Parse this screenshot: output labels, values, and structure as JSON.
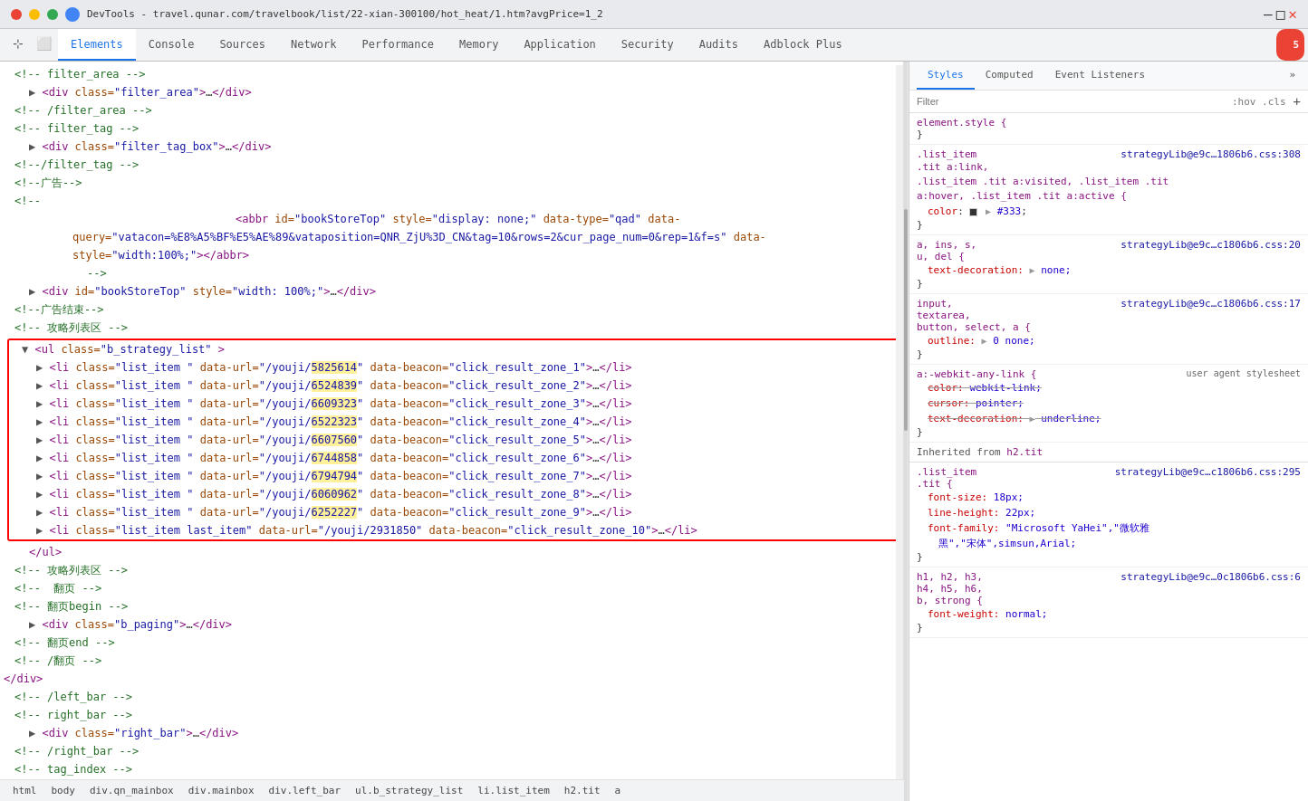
{
  "window": {
    "title": "DevTools - travel.qunar.com/travelbook/list/22-xian-300100/hot_heat/1.htm?avgPrice=1_2",
    "minimize_btn": "—",
    "maximize_btn": "□",
    "close_btn": "✕"
  },
  "tabs": {
    "items": [
      {
        "label": "Elements",
        "active": true
      },
      {
        "label": "Console",
        "active": false
      },
      {
        "label": "Sources",
        "active": false
      },
      {
        "label": "Network",
        "active": false
      },
      {
        "label": "Performance",
        "active": false
      },
      {
        "label": "Memory",
        "active": false
      },
      {
        "label": "Application",
        "active": false
      },
      {
        "label": "Security",
        "active": false
      },
      {
        "label": "Audits",
        "active": false
      },
      {
        "label": "Adblock Plus",
        "active": false
      }
    ],
    "error_count": "5"
  },
  "toolbar": {
    "inspect_icon": "⊹",
    "device_icon": "⬜"
  },
  "styles_panel": {
    "tabs": [
      "Styles",
      "Computed",
      "Event Listeners"
    ],
    "more_label": "»",
    "filter_placeholder": "Filter",
    "filter_hint": ":hov .cls",
    "add_icon": "+",
    "rules": [
      {
        "selector": "element.style {",
        "source": "",
        "props": [],
        "close": "}"
      },
      {
        "selector": ".list_item",
        "source": "strategyLib@e9c…1806b6.css:308",
        "extra_selectors": ".tit a:link,\n.list_item .tit a:visited, .list_item .tit\na:hover, .list_item .tit a:active {",
        "props": [
          {
            "name": "color",
            "value": "#333",
            "swatch": "#333333",
            "arrow": true
          }
        ],
        "close": "}"
      },
      {
        "selector": "a, ins, s,",
        "source": "strategyLib@e9c…c1806b6.css:20",
        "extra": "u, del {",
        "props": [
          {
            "name": "text-decoration:",
            "value": "none;",
            "arrow": true
          }
        ],
        "close": "}"
      },
      {
        "selector": "input,",
        "source": "strategyLib@e9c…c1806b6.css:17",
        "extra": "textarea,\nbutton, select, a {",
        "props": [
          {
            "name": "outline:",
            "value": "0 none;",
            "arrow": true
          }
        ],
        "close": "}"
      },
      {
        "selector": "a:-webkit-any-link {",
        "source": "",
        "user_agent": "user agent stylesheet",
        "props": [
          {
            "name": "color:",
            "value": "webkit-link;",
            "strikethrough": true
          },
          {
            "name": "cursor:",
            "value": "pointer;",
            "strikethrough": true
          },
          {
            "name": "text-decoration:",
            "value": "underline;",
            "strikethrough": true,
            "arrow": true
          }
        ],
        "close": "}"
      },
      {
        "inherited_from": "h2.tit",
        "selector": ".list_item",
        "source": "strategyLib@e9c…c1806b6.css:295",
        "extra": ".tit {",
        "props": [
          {
            "name": "font-size:",
            "value": "18px;"
          },
          {
            "name": "line-height:",
            "value": "22px;"
          },
          {
            "name": "font-family:",
            "value": "\"Microsoft YaHei\",\"微软雅\n    黑\",\"宋体\",simsun,Arial;"
          }
        ],
        "close": "}"
      },
      {
        "selector": "h1, h2, h3,",
        "source": "strategyLib@e9c…0c1806b6.css:6",
        "extra": "h4, h5, h6,\nb, strong {",
        "props": [
          {
            "name": "font-weight:",
            "value": "normal;"
          }
        ],
        "close": "}"
      }
    ]
  },
  "dom": {
    "lines": [
      {
        "indent": 1,
        "type": "comment",
        "text": "<!-- filter_area -->"
      },
      {
        "indent": 2,
        "type": "tag_collapsed",
        "text": "<div class=\"filter_area\">…</div>"
      },
      {
        "indent": 1,
        "type": "comment",
        "text": "<!-- /filter_area -->"
      },
      {
        "indent": 1,
        "type": "comment",
        "text": "<!-- filter_tag -->"
      },
      {
        "indent": 2,
        "type": "tag_collapsed",
        "text": "<div class=\"filter_tag_box\">…</div>"
      },
      {
        "indent": 1,
        "type": "comment",
        "text": "<!-/filter_tag -->"
      },
      {
        "indent": 1,
        "type": "comment",
        "text": "<!--广告-->"
      },
      {
        "indent": 1,
        "type": "comment",
        "text": "<!--"
      },
      {
        "indent": 5,
        "type": "tag",
        "text": "<abbr id=\"bookStoreTop\" style=\"display: none;\" data-type=\"qad\" data-"
      },
      {
        "indent": 5,
        "type": "text",
        "text": "query=\"vatacon=%E8%A5%BF%E5%AE%89&vataposition=QNR_ZjU%3D_CN&tag=10&rows=2&cur_page_num=0&rep=1&f=s\" data-"
      },
      {
        "indent": 5,
        "type": "text",
        "text": "style=\"width:100%;\"></abbr>"
      },
      {
        "indent": 6,
        "type": "text",
        "text": "-->"
      },
      {
        "indent": 2,
        "type": "tag_collapsed",
        "text": "<div id=\"bookStoreTop\" style=\"width: 100%;\">…</div>"
      },
      {
        "indent": 1,
        "type": "comment",
        "text": "<!--广告结束-->"
      },
      {
        "indent": 1,
        "type": "comment",
        "text": "<!-- 攻略列表区 -->"
      },
      {
        "indent": 2,
        "type": "ul_open",
        "text": "<ul class=\"b_strategy_list\" >"
      },
      {
        "indent": 3,
        "type": "li",
        "text": "<li class=\"list_item \" data-url=\"/youji/5825614\" data-beacon=\"click_result_zone_1\">…</li>"
      },
      {
        "indent": 3,
        "type": "li",
        "text": "<li class=\"list_item \" data-url=\"/youji/6524839\" data-beacon=\"click_result_zone_2\">…</li>"
      },
      {
        "indent": 3,
        "type": "li",
        "text": "<li class=\"list_item \" data-url=\"/youji/6609323\" data-beacon=\"click_result_zone_3\">…</li>"
      },
      {
        "indent": 3,
        "type": "li",
        "text": "<li class=\"list_item \" data-url=\"/youji/6522323\" data-beacon=\"click_result_zone_4\">…</li>"
      },
      {
        "indent": 3,
        "type": "li",
        "text": "<li class=\"list_item \" data-url=\"/youji/6607560\" data-beacon=\"click_result_zone_5\">…</li>"
      },
      {
        "indent": 3,
        "type": "li",
        "text": "<li class=\"list_item \" data-url=\"/youji/6744858\" data-beacon=\"click_result_zone_6\">…</li>"
      },
      {
        "indent": 3,
        "type": "li",
        "text": "<li class=\"list_item \" data-url=\"/youji/6794794\" data-beacon=\"click_result_zone_7\">…</li>"
      },
      {
        "indent": 3,
        "type": "li",
        "text": "<li class=\"list_item \" data-url=\"/youji/6060962\" data-beacon=\"click_result_zone_8\">…</li>"
      },
      {
        "indent": 3,
        "type": "li",
        "text": "<li class=\"list_item \" data-url=\"/youji/6252227\" data-beacon=\"click_result_zone_9\">…</li>"
      },
      {
        "indent": 3,
        "type": "li_last",
        "text": "<li class=\"list_item last_item\" data-url=\"/youji/2931850\" data-beacon=\"click_result_zone_10\">…</li>"
      },
      {
        "indent": 2,
        "type": "ul_close",
        "text": "</ul>"
      },
      {
        "indent": 1,
        "type": "comment",
        "text": "<!-- 攻略列表区 -->"
      },
      {
        "indent": 1,
        "type": "comment",
        "text": "<!--  翻页 -->"
      },
      {
        "indent": 1,
        "type": "comment",
        "text": "<!-- 翻页begin -->"
      },
      {
        "indent": 2,
        "type": "tag_collapsed",
        "text": "<div class=\"b_paging\">…</div>"
      },
      {
        "indent": 1,
        "type": "comment",
        "text": "<!-- 翻页end -->"
      },
      {
        "indent": 1,
        "type": "comment",
        "text": "<!-- /翻页 -->"
      },
      {
        "indent": 0,
        "type": "tag_plain",
        "text": "</div>"
      },
      {
        "indent": 1,
        "type": "comment",
        "text": "<!-- /left_bar -->"
      },
      {
        "indent": 1,
        "type": "comment",
        "text": "<!-- right_bar -->"
      },
      {
        "indent": 2,
        "type": "tag_collapsed",
        "text": "<div class=\"right_bar\">…</div>"
      },
      {
        "indent": 1,
        "type": "comment",
        "text": "<!-- /right_bar -->"
      },
      {
        "indent": 1,
        "type": "comment",
        "text": "<!-- tag_index -->"
      }
    ]
  },
  "breadcrumb": {
    "items": [
      "html",
      "body",
      "div.qn_mainbox",
      "div.mainbox",
      "div.left_bar",
      "ul.b_strategy_list",
      "li.list_item",
      "h2.tit",
      "a"
    ]
  }
}
